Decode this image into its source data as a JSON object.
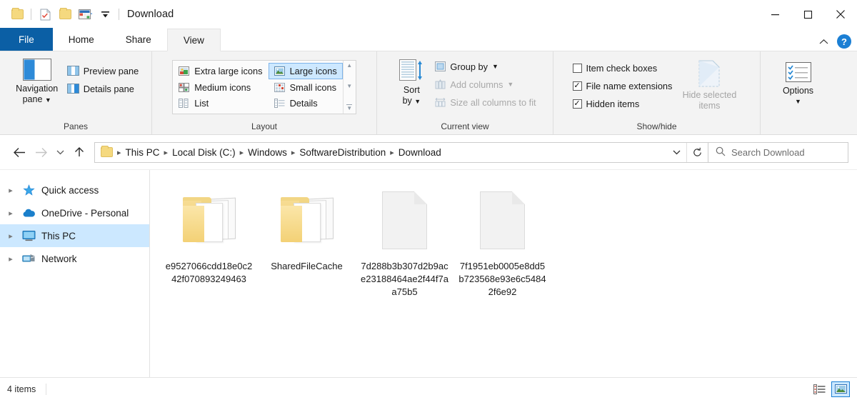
{
  "window": {
    "title": "Download",
    "quick_access": [
      {
        "name": "folder-icon",
        "label": "Folder"
      },
      {
        "name": "properties-icon",
        "label": "Properties"
      },
      {
        "name": "new-folder-icon",
        "label": "New folder"
      },
      {
        "name": "customize-gallery-icon",
        "label": "Customize"
      },
      {
        "name": "customize-qat-icon",
        "label": "Customize Quick Access Toolbar"
      }
    ],
    "controls": {
      "minimize": "—",
      "maximize": "☐",
      "close": "✕"
    }
  },
  "ribbon": {
    "tabs": [
      {
        "label": "File",
        "kind": "file"
      },
      {
        "label": "Home",
        "kind": "normal"
      },
      {
        "label": "Share",
        "kind": "normal"
      },
      {
        "label": "View",
        "kind": "active"
      }
    ],
    "collapse_label": "⌃",
    "help_label": "?",
    "groups": {
      "panes": {
        "label": "Panes",
        "navigation_pane": "Navigation\npane",
        "navigation_pane_line1": "Navigation",
        "navigation_pane_line2": "pane",
        "preview_pane": "Preview pane",
        "details_pane": "Details pane"
      },
      "layout": {
        "label": "Layout",
        "items": [
          {
            "label": "Extra large icons",
            "selected": false
          },
          {
            "label": "Large icons",
            "selected": true
          },
          {
            "label": "Medium icons",
            "selected": false
          },
          {
            "label": "Small icons",
            "selected": false
          },
          {
            "label": "List",
            "selected": false
          },
          {
            "label": "Details",
            "selected": false
          }
        ]
      },
      "current_view": {
        "label": "Current view",
        "sort_by_line1": "Sort",
        "sort_by_line2": "by",
        "group_by": "Group by",
        "add_columns": "Add columns",
        "size_all_columns": "Size all columns to fit"
      },
      "show_hide": {
        "label": "Show/hide",
        "item_check_boxes": {
          "label": "Item check boxes",
          "checked": false
        },
        "file_name_extensions": {
          "label": "File name extensions",
          "checked": true
        },
        "hidden_items": {
          "label": "Hidden items",
          "checked": true
        },
        "hide_selected_line1": "Hide selected",
        "hide_selected_line2": "items"
      },
      "options": {
        "label": "Options"
      }
    }
  },
  "addressbar": {
    "back_label": "←",
    "forward_label": "→",
    "recent_label": "⌄",
    "up_label": "↑",
    "breadcrumbs": [
      "This PC",
      "Local Disk (C:)",
      "Windows",
      "SoftwareDistribution",
      "Download"
    ],
    "separator": "›",
    "dropdown_label": "⌄",
    "refresh_label": "↻",
    "search_placeholder": "Search Download"
  },
  "navpane": {
    "items": [
      {
        "label": "Quick access",
        "icon": "star-icon",
        "selected": false
      },
      {
        "label": "OneDrive - Personal",
        "icon": "cloud-icon",
        "selected": false
      },
      {
        "label": "This PC",
        "icon": "monitor-icon",
        "selected": true
      },
      {
        "label": "Network",
        "icon": "network-icon",
        "selected": false
      }
    ],
    "chevron": "›"
  },
  "files": [
    {
      "name": "e9527066cdd18e0c242f07089324946 3",
      "display": "e9527066cdd18e0c242f070893249463",
      "type": "folder"
    },
    {
      "name": "SharedFileCache",
      "display": "SharedFileCache",
      "type": "folder"
    },
    {
      "name": "7d288b3b307d2b9ace23188464ae2f44f7aa75b5",
      "display": "7d288b3b307d2b9ace23188464ae2f44f7aa75b5",
      "type": "file"
    },
    {
      "name": "7f1951eb0005e8dd5b723568e93e6c54842f6e92",
      "display": "7f1951eb0005e8dd5b723568e93e6c54842f6e92",
      "type": "file"
    }
  ],
  "statusbar": {
    "item_count": "4 items",
    "view_details_label": "Details view",
    "view_large_icons_label": "Large icons view"
  },
  "colors": {
    "accent": "#0b5fa5",
    "selection": "#cce8ff",
    "ribbon_bg": "#f3f3f3",
    "folder": "#f2d685"
  }
}
